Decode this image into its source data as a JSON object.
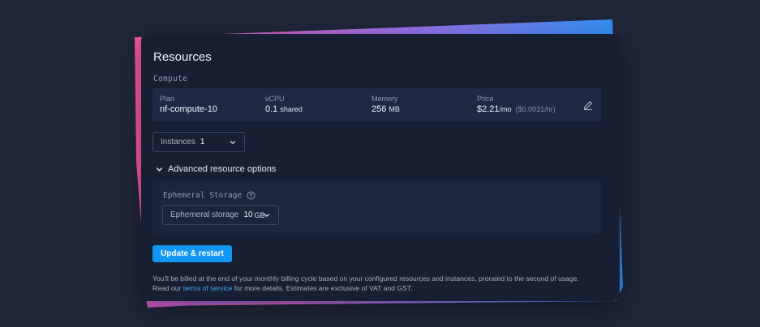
{
  "page": {
    "title": "Resources",
    "section_label": "Compute"
  },
  "plan": {
    "plan_label": "Plan",
    "plan_value": "nf-compute-10",
    "vcpu_label": "vCPU",
    "vcpu_value": "0.1",
    "vcpu_unit": "shared",
    "memory_label": "Memory",
    "memory_value": "256",
    "memory_unit": "MB",
    "price_label": "Price",
    "price_value": "$2.21",
    "price_unit": "/mo",
    "price_hourly": "($0.0031/hr)",
    "edit_icon": "pencil-icon"
  },
  "instances": {
    "label": "Instances",
    "value": "1"
  },
  "advanced": {
    "toggle_label": "Advanced resource options",
    "storage_label": "Ephemeral Storage",
    "select_label": "Ephemeral storage",
    "select_value": "10",
    "select_unit": "GB"
  },
  "actions": {
    "update_label": "Update & restart"
  },
  "billing": {
    "text_1": "You'll be billed at the end of your monthly billing cycle based on your configured resources and instances, prorated to the second of usage.",
    "text_2": "Read our",
    "link": "terms of service",
    "text_3": "for more details. Estimates are exclusive of VAT and GST."
  },
  "colors": {
    "background": "#1f2637",
    "card": "#172033",
    "accent": "#1296f2",
    "link": "#3aa4f5",
    "decor_pink": "#f0559c",
    "decor_blue": "#2e8ff0"
  }
}
